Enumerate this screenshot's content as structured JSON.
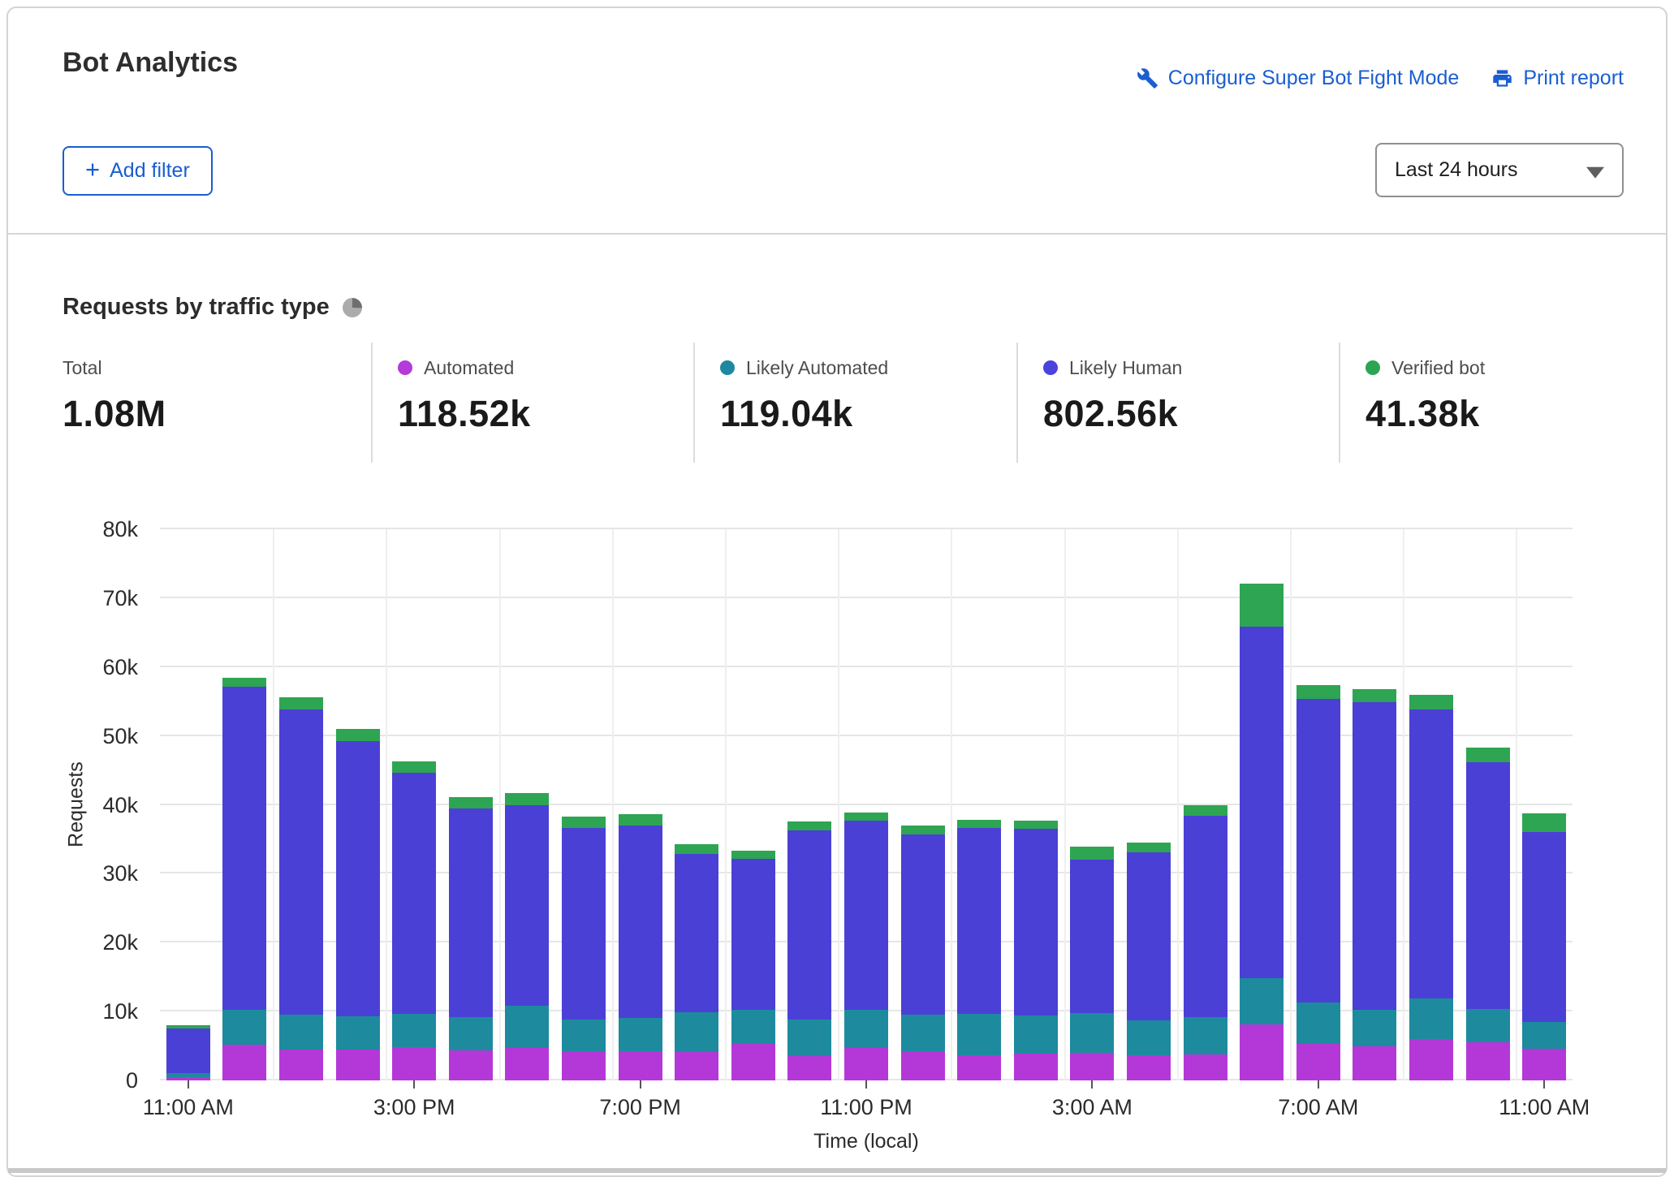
{
  "header": {
    "title": "Bot Analytics",
    "configure_link_label": "Configure Super Bot Fight Mode",
    "print_link_label": "Print report",
    "add_filter_label": "Add filter",
    "plus_glyph": "+",
    "time_range_value": "Last 24 hours"
  },
  "section": {
    "title": "Requests by traffic type"
  },
  "stats": [
    {
      "label": "Total",
      "value": "1.08M"
    },
    {
      "label": "Automated",
      "value": "118.52k",
      "color": "#b43ad9"
    },
    {
      "label": "Likely Automated",
      "value": "119.04k",
      "color": "#1d89a0"
    },
    {
      "label": "Likely Human",
      "value": "802.56k",
      "color": "#4c43dd"
    },
    {
      "label": "Verified bot",
      "value": "41.38k",
      "color": "#2ba551"
    }
  ],
  "chart_data": {
    "type": "bar",
    "stacked": true,
    "title": "Requests by traffic type",
    "xlabel": "Time (local)",
    "ylabel": "Requests",
    "ylim_k": [
      0,
      80
    ],
    "ytick_step_k": 10,
    "ytick_labels": [
      "0",
      "10k",
      "20k",
      "30k",
      "40k",
      "50k",
      "60k",
      "70k",
      "80k"
    ],
    "xtick_every": 4,
    "xtick_labels_shown": [
      "11:00 AM",
      "3:00 PM",
      "7:00 PM",
      "11:00 PM",
      "3:00 AM",
      "7:00 AM",
      "11:00 AM"
    ],
    "grid": true,
    "legend_position": "top-stats-row",
    "x": [
      "11:00 AM",
      "12:00 PM",
      "1:00 PM",
      "2:00 PM",
      "3:00 PM",
      "4:00 PM",
      "5:00 PM",
      "6:00 PM",
      "7:00 PM",
      "8:00 PM",
      "9:00 PM",
      "10:00 PM",
      "11:00 PM",
      "12:00 AM",
      "1:00 AM",
      "2:00 AM",
      "3:00 AM",
      "4:00 AM",
      "5:00 AM",
      "6:00 AM",
      "7:00 AM",
      "8:00 AM",
      "9:00 AM",
      "10:00 AM",
      "11:00 AM"
    ],
    "series": [
      {
        "name": "Automated",
        "color": "#b438d8",
        "values_k": [
          0.5,
          5.2,
          4.5,
          4.5,
          4.8,
          4.4,
          4.7,
          4.2,
          4.3,
          4.1,
          5.3,
          3.5,
          4.7,
          4.2,
          3.6,
          3.9,
          4.0,
          3.7,
          3.8,
          8.1,
          5.3,
          4.9,
          6.0,
          5.5,
          4.6
        ]
      },
      {
        "name": "Likely Automated",
        "color": "#1d8a9e",
        "values_k": [
          0.6,
          5.0,
          5.0,
          4.8,
          4.9,
          4.8,
          6.1,
          4.6,
          4.8,
          5.8,
          5.0,
          5.3,
          5.6,
          5.3,
          6.1,
          5.5,
          5.8,
          5.0,
          5.4,
          6.8,
          6.0,
          5.4,
          5.9,
          4.9,
          3.9
        ]
      },
      {
        "name": "Likely Human",
        "color": "#4a40d6",
        "values_k": [
          6.4,
          47.0,
          44.3,
          39.9,
          35.0,
          30.3,
          29.1,
          27.8,
          27.9,
          23.0,
          21.9,
          27.5,
          27.4,
          26.2,
          26.9,
          27.1,
          22.3,
          24.4,
          29.2,
          51.0,
          44.1,
          44.6,
          41.9,
          35.8,
          27.5
        ]
      },
      {
        "name": "Verified bot",
        "color": "#2ea552",
        "values_k": [
          0.5,
          1.3,
          1.8,
          1.8,
          1.6,
          1.6,
          1.8,
          1.7,
          1.6,
          1.4,
          1.1,
          1.3,
          1.2,
          1.3,
          1.2,
          1.2,
          1.8,
          1.4,
          1.6,
          6.2,
          2.0,
          1.9,
          2.2,
          2.1,
          2.8
        ]
      }
    ]
  }
}
